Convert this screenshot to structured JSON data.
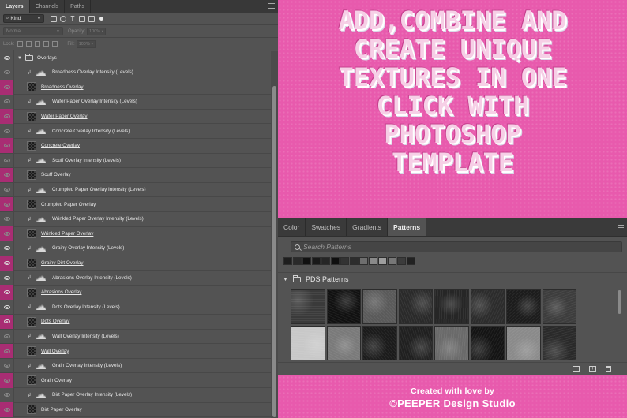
{
  "layers_panel": {
    "tabs": [
      "Layers",
      "Channels",
      "Paths"
    ],
    "filter": {
      "kind_label": "Kind"
    },
    "blend": {
      "mode": "Normal",
      "opacity_label": "Opacity:",
      "opacity_value": "100%"
    },
    "lock": {
      "label": "Lock:",
      "fill_label": "Fill:",
      "fill_value": "100%"
    },
    "group": {
      "name": "Overlays"
    },
    "layers": [
      {
        "name": "Broadness Overlay Intensity (Levels)",
        "type": "adjustment",
        "visible": false,
        "pink": false
      },
      {
        "name": "Broadness Overlay",
        "type": "pattern",
        "visible": false,
        "pink": true
      },
      {
        "name": "Wafer Paper Overlay Intensity (Levels)",
        "type": "adjustment",
        "visible": false,
        "pink": false
      },
      {
        "name": "Wafer Paper Overlay",
        "type": "pattern",
        "visible": false,
        "pink": true
      },
      {
        "name": "Concrete Overlay Intensity (Levels)",
        "type": "adjustment",
        "visible": false,
        "pink": false
      },
      {
        "name": "Concrete Overlay",
        "type": "pattern",
        "visible": false,
        "pink": true
      },
      {
        "name": "Scuff Overlay Intensity (Levels)",
        "type": "adjustment",
        "visible": false,
        "pink": false
      },
      {
        "name": "Scuff Overlay",
        "type": "pattern",
        "visible": false,
        "pink": true
      },
      {
        "name": "Crumpled Paper Overlay Intensity (Levels)",
        "type": "adjustment",
        "visible": false,
        "pink": false
      },
      {
        "name": "Crumpled Paper Overlay",
        "type": "pattern",
        "visible": false,
        "pink": true
      },
      {
        "name": "Wrinkled Paper Overlay Intensity (Levels)",
        "type": "adjustment",
        "visible": false,
        "pink": false
      },
      {
        "name": "Wrinkled Paper Overlay",
        "type": "pattern",
        "visible": false,
        "pink": true
      },
      {
        "name": "Grainy Overlay  Intensity (Levels)",
        "type": "adjustment",
        "visible": true,
        "pink": false
      },
      {
        "name": "Grainy Dirt Overlay",
        "type": "pattern",
        "visible": true,
        "pink": true
      },
      {
        "name": "Abrasions Overlay Intensity (Levels)",
        "type": "adjustment",
        "visible": true,
        "pink": false
      },
      {
        "name": "Abrasions Overlay",
        "type": "pattern",
        "visible": true,
        "pink": true
      },
      {
        "name": "Dots Overlay Intensity (Levels)",
        "type": "adjustment",
        "visible": true,
        "pink": false
      },
      {
        "name": "Dots Overlay",
        "type": "pattern",
        "visible": true,
        "pink": true
      },
      {
        "name": "Wall Overlay Intensity (Levels)",
        "type": "adjustment",
        "visible": false,
        "pink": false
      },
      {
        "name": "Wall Overlay",
        "type": "pattern",
        "visible": false,
        "pink": true
      },
      {
        "name": "Grain Overlay Intensity (Levels)",
        "type": "adjustment",
        "visible": false,
        "pink": false
      },
      {
        "name": "Grain Overlay",
        "type": "pattern",
        "visible": false,
        "pink": true
      },
      {
        "name": "Dirt Paper Overlay Intensity (Levels)",
        "type": "adjustment",
        "visible": false,
        "pink": false
      },
      {
        "name": "Dirt Paper Overlay",
        "type": "pattern",
        "visible": false,
        "pink": true
      }
    ]
  },
  "canvas": {
    "headline_lines": [
      "ADD,COMBINE AND",
      "CREATE UNIQUE",
      "TEXTURES IN ONE",
      "CLICK WITH",
      "PHOTOSHOP",
      "TEMPLATE"
    ],
    "credit_line1": "Created with love by",
    "credit_line2": "©PEEPER Design Studio"
  },
  "patterns_panel": {
    "tabs": [
      "Color",
      "Swatches",
      "Gradients",
      "Patterns"
    ],
    "active_tab": "Patterns",
    "search_placeholder": "Search Patterns",
    "folder_name": "PDS Patterns",
    "recent_swatch_colors": [
      "#1e1e1e",
      "#2a2a2a",
      "#111111",
      "#1a1a1a",
      "#262626",
      "#0f0f0f",
      "#333333",
      "#2d2d2d",
      "#6e6e6e",
      "#8a8a8a",
      "#9e9e9e",
      "#777777",
      "#3c3c3c",
      "#222222"
    ],
    "pattern_tiles": [
      "#3a3a3a",
      "#111111",
      "#5a5a5a",
      "#2a2a2a",
      "#262626",
      "#2c2c2c",
      "#1c1c1c",
      "#3d3d3d",
      "#c8c8c8",
      "#7a7a7a",
      "#1b1b1b",
      "#202020",
      "#6a6a6a",
      "#141414",
      "#8a8a8a",
      "#2a2a2a"
    ]
  },
  "colors": {
    "accent_pink": "#e85aad",
    "eye_pink": "#a82d73"
  }
}
